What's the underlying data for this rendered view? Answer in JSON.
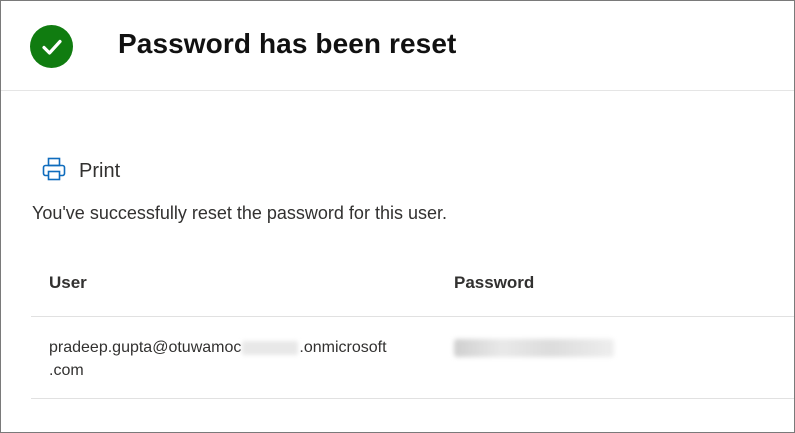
{
  "header": {
    "title": "Password has been reset",
    "icon": "check-circle-icon",
    "icon_color": "#107c10"
  },
  "toolbar": {
    "print_label": "Print",
    "print_icon": "printer-icon",
    "print_icon_color": "#0f6cbd"
  },
  "message": "You've successfully reset the password for this user.",
  "table": {
    "columns": [
      "User",
      "Password"
    ],
    "rows": [
      {
        "user_prefix": "pradeep.gupta@otuwamoc",
        "user_redacted": "●●●●●",
        "user_suffix": ".onmicrosoft",
        "user_line2": ".com",
        "password_redacted": "●●●●●●●●●●●"
      }
    ]
  }
}
